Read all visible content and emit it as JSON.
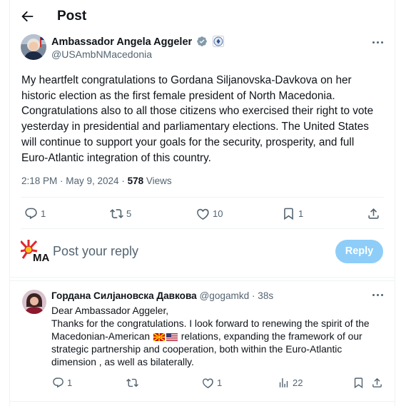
{
  "header": {
    "title": "Post"
  },
  "post": {
    "author_name": "Ambassador Angela Aggeler",
    "author_handle": "@USAmbNMacedonia",
    "text": "My heartfelt congratulations to Gordana Siljanovska-Davkova on her historic election as the first female president of North Macedonia. Congratulations also to all those citizens who exercised their right to vote yesterday in presidential and parliamentary elections. The United States will continue to support your goals for the security, prosperity, and full Euro-Atlantic integration of this country.",
    "time": "2:18 PM · May 9, 2024 · ",
    "views_count": "578",
    "views_label": " Views",
    "replies": "1",
    "reposts": "5",
    "likes": "10",
    "bookmarks": "1"
  },
  "compose": {
    "placeholder": "Post your reply",
    "button": "Reply"
  },
  "reply": {
    "author_name": "Гордана Силјановска Давкова",
    "author_handle": "@gogamkd · 38s",
    "line1": "Dear Ambassador Aggeler,",
    "line2_before": "Thanks for the congratulations. I look forward to renewing the spirit of the Macedonian-American",
    "line2_after": "relations, expanding the framework of our strategic partnership and cooperation, both within the Euro-Atlantic dimension , as well as bilaterally.",
    "replies": "1",
    "likes": "1",
    "views": "22"
  },
  "icons": {
    "back": "arrow-left-icon",
    "verified": "verified-badge-icon",
    "affiliate": "us-seal-icon",
    "more": "more-icon",
    "reply": "reply-icon",
    "repost": "repost-icon",
    "like": "heart-icon",
    "bookmark": "bookmark-icon",
    "share": "share-icon",
    "views": "views-bars-icon"
  },
  "colors": {
    "accent": "#1d9bf0",
    "accent_disabled": "#8ecdf8",
    "secondary_text": "#536471",
    "verified_gray": "#829aab"
  }
}
